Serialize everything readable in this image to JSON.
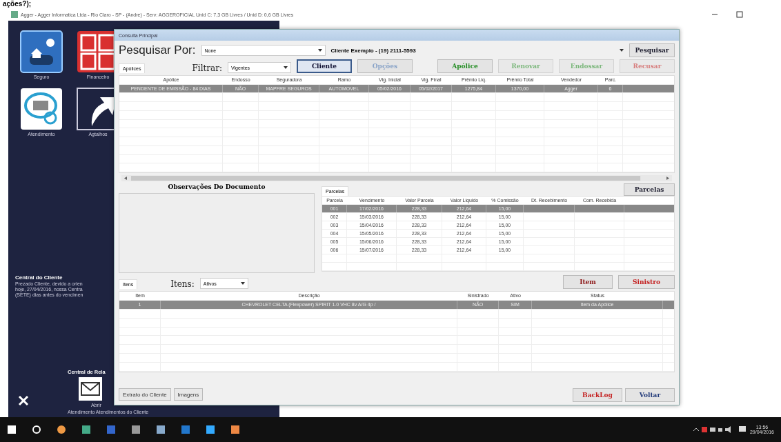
{
  "top_fragment": "ações?);",
  "window": {
    "title": "Agger - Agger Informatica Ltda - Rio Claro - SP - (Andre) - Serv: AGGEROFICIAL Unid C: 7,3 GB Livres / Unid D: 0,6 GB Livres"
  },
  "desktop": {
    "shortcuts": [
      {
        "label": "Seguro",
        "kind": "seguro"
      },
      {
        "label": "Financeiro",
        "kind": "financeiro"
      },
      {
        "label": "Atendimento",
        "kind": "atendimento"
      },
      {
        "label": "Agtalhos",
        "kind": "atalhos"
      }
    ],
    "notice": {
      "title": "Central do Cliente",
      "lines": [
        "Prezado Cliente, devido a orien",
        "hoje, 27/04/2016, nossa Centra",
        "(SETE) dias antes do vencimen"
      ]
    },
    "relations": {
      "title": "Central de Rela",
      "caption_top": "Abrir",
      "caption_bottom": "Atendimento Atendimentos  do Cliente"
    }
  },
  "dialog": {
    "title": "Consulta Principal",
    "search_label": "Pesquisar Por:",
    "search_by": "None",
    "client": "Cliente Exemplo - (19) 2111-5593",
    "search_button": "Pesquisar",
    "tab": "Apólices",
    "filter_label": "Filtrar:",
    "filter": "Vigentes",
    "actions": [
      {
        "label": "Cliente",
        "kind": "focus",
        "disabled": false
      },
      {
        "label": "Opções",
        "kind": "plain",
        "disabled": true
      },
      {
        "label": "Apólice",
        "kind": "green",
        "disabled": false
      },
      {
        "label": "Renovar",
        "kind": "green",
        "disabled": true
      },
      {
        "label": "Endossar",
        "kind": "green",
        "disabled": true
      },
      {
        "label": "Recusar",
        "kind": "red",
        "disabled": true
      }
    ],
    "policies": {
      "columns": [
        "Apólice",
        "Endosso",
        "Seguradora",
        "Ramo",
        "Vig. Inicial",
        "Vig. Final",
        "Prêmio Líq.",
        "Prêmio Total",
        "Vendedor",
        "Parc."
      ],
      "rows": [
        {
          "selected": true,
          "cells": [
            "PENDENTE DE EMISSÃO - 84 DIAS",
            "NÃO",
            "MAPFRE SEGUROS",
            "AUTOMOVEL",
            "05/02/2016",
            "05/02/2017",
            "1275,84",
            "1370,00",
            "Agger",
            "6"
          ]
        }
      ]
    },
    "notes_label": "Observações Do Documento",
    "installments_tab": "Parcelas",
    "installments_button": "Parcelas",
    "installments": {
      "columns": [
        "Parcela",
        "Vencimento",
        "Valor Parcela",
        "Valor Liquido",
        "% Comissão",
        "Dt. Recebimento",
        "Com. Recebida"
      ],
      "rows": [
        {
          "selected": true,
          "cells": [
            "001",
            "17/02/2016",
            "228,33",
            "212,64",
            "15,00"
          ]
        },
        {
          "selected": false,
          "cells": [
            "002",
            "15/03/2016",
            "228,33",
            "212,64",
            "15,00"
          ]
        },
        {
          "selected": false,
          "cells": [
            "003",
            "15/04/2016",
            "228,33",
            "212,64",
            "15,00"
          ]
        },
        {
          "selected": false,
          "cells": [
            "004",
            "15/05/2016",
            "228,33",
            "212,64",
            "15,00"
          ]
        },
        {
          "selected": false,
          "cells": [
            "005",
            "15/06/2016",
            "228,33",
            "212,64",
            "15,00"
          ]
        },
        {
          "selected": false,
          "cells": [
            "006",
            "15/07/2016",
            "228,33",
            "212,64",
            "15,00"
          ]
        }
      ]
    },
    "items_tab": "Itens",
    "items_label": "Itens:",
    "items_filter": "Ativos",
    "item_button": "Item",
    "claim_button": "Sinistro",
    "items": {
      "columns": [
        "Item",
        "Descrição",
        "Sinistrado",
        "Ativo",
        "Status"
      ],
      "rows": [
        {
          "selected": true,
          "cells": [
            "1",
            "CHEVROLET CELTA (Flexpower) SPIRIT 1.0 VHC 8v A/G 4p /",
            "NÃO",
            "SIM",
            "Item da Apólice"
          ]
        }
      ]
    },
    "footer_left": [
      "Extrato do Cliente",
      "Imagens"
    ],
    "backlog_button": "BackLog",
    "back_button": "Voltar"
  },
  "taskbar": {
    "time": "13:56",
    "date": "29/04/2016"
  }
}
